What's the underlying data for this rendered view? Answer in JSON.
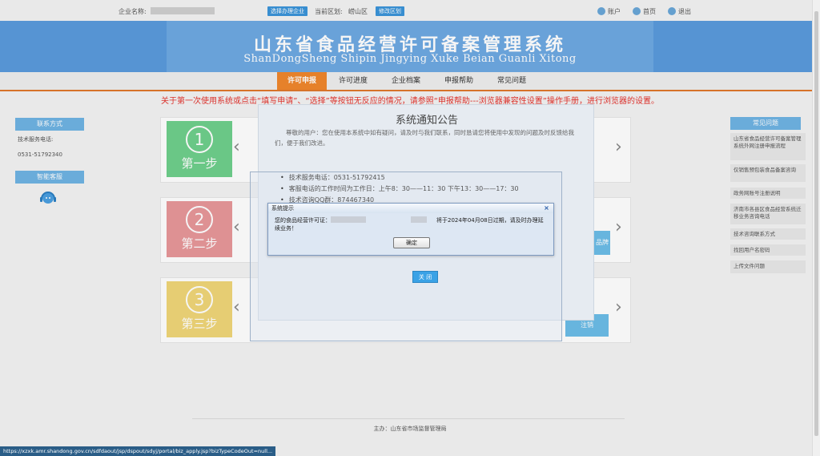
{
  "topbar": {
    "company_label": "企业名称:",
    "select_company_btn": "选择办理企业",
    "region_label": "当前区划:",
    "region_value": "崂山区",
    "change_region_btn": "修改区划",
    "account": "账户",
    "home": "首页",
    "logout": "退出"
  },
  "banner": {
    "title": "山东省食品经营许可备案管理系统",
    "subtitle": "ShanDongSheng Shipin Jingying Xuke Beian Guanli Xitong"
  },
  "nav": {
    "items": [
      "许可申报",
      "许可进度",
      "企业档案",
      "申报帮助",
      "常见问题"
    ],
    "active_index": 0
  },
  "notice": "关于第一次使用系统或点击“填写申请”、“选择”等按钮无反应的情况，请参照“申报帮助---浏览器兼容性设置”操作手册，进行浏览器的设置。",
  "left_panel": {
    "contact_title": "联系方式",
    "service_label": "技术服务电话:",
    "service_phone": "0531-51792340",
    "smart_service_title": "智能客服"
  },
  "right_panel": {
    "title": "常见问题",
    "items": [
      "山东省食品经营许可备案管理系统外网注册申报流程",
      "仅销售预包装食品备案咨询",
      "政务网账号注册说明",
      "济南市各县区食品经营系统迁移业务咨询电话",
      "技术咨询联系方式",
      "找回用户名密码",
      "上传文件问题"
    ]
  },
  "steps": [
    {
      "num": "1",
      "label": "第一步",
      "color": "#6fd08c"
    },
    {
      "num": "2",
      "label": "第二步",
      "color": "#e8979a"
    },
    {
      "num": "3",
      "label": "第三步",
      "color": "#f0d678"
    }
  ],
  "step_tabs": {
    "second": "品牌",
    "third": "注销"
  },
  "announcement": {
    "title": "系统通知公告",
    "intro": "尊敬的用户：您在使用本系统中如有疑问，请及时与我们联系，同时恳请您将使用中发现的问题及时反馈给我们，便于我们改进。",
    "items": [
      "技术服务电话：0531-51792415",
      "客服电话的工作时间为工作日：上午8：30——11：30  下午13：30——17：30",
      "技术咨询QQ群：874467340"
    ],
    "close_btn": "关 闭"
  },
  "dialog": {
    "title": "系统提示",
    "close_icon": "×",
    "message_prefix": "您的食品经营许可证：",
    "message_suffix": "将于2024年04月08日过期，请及时办理延续业务！",
    "ok_btn": "确定"
  },
  "footer": {
    "text": "主办：山东省市场监督管理局"
  },
  "statusbar": {
    "url": "https://xzxk.amr.shandong.gov.cn/sdfdaout/jsp/dspout/sdyj/portal/biz_apply.jsp?bizTypeCodeOut=null..."
  },
  "colors": {
    "banner": "#5a9bdc",
    "nav_active": "#f0872c",
    "notice": "#e4332d",
    "side_head": "#6fb4e3"
  }
}
